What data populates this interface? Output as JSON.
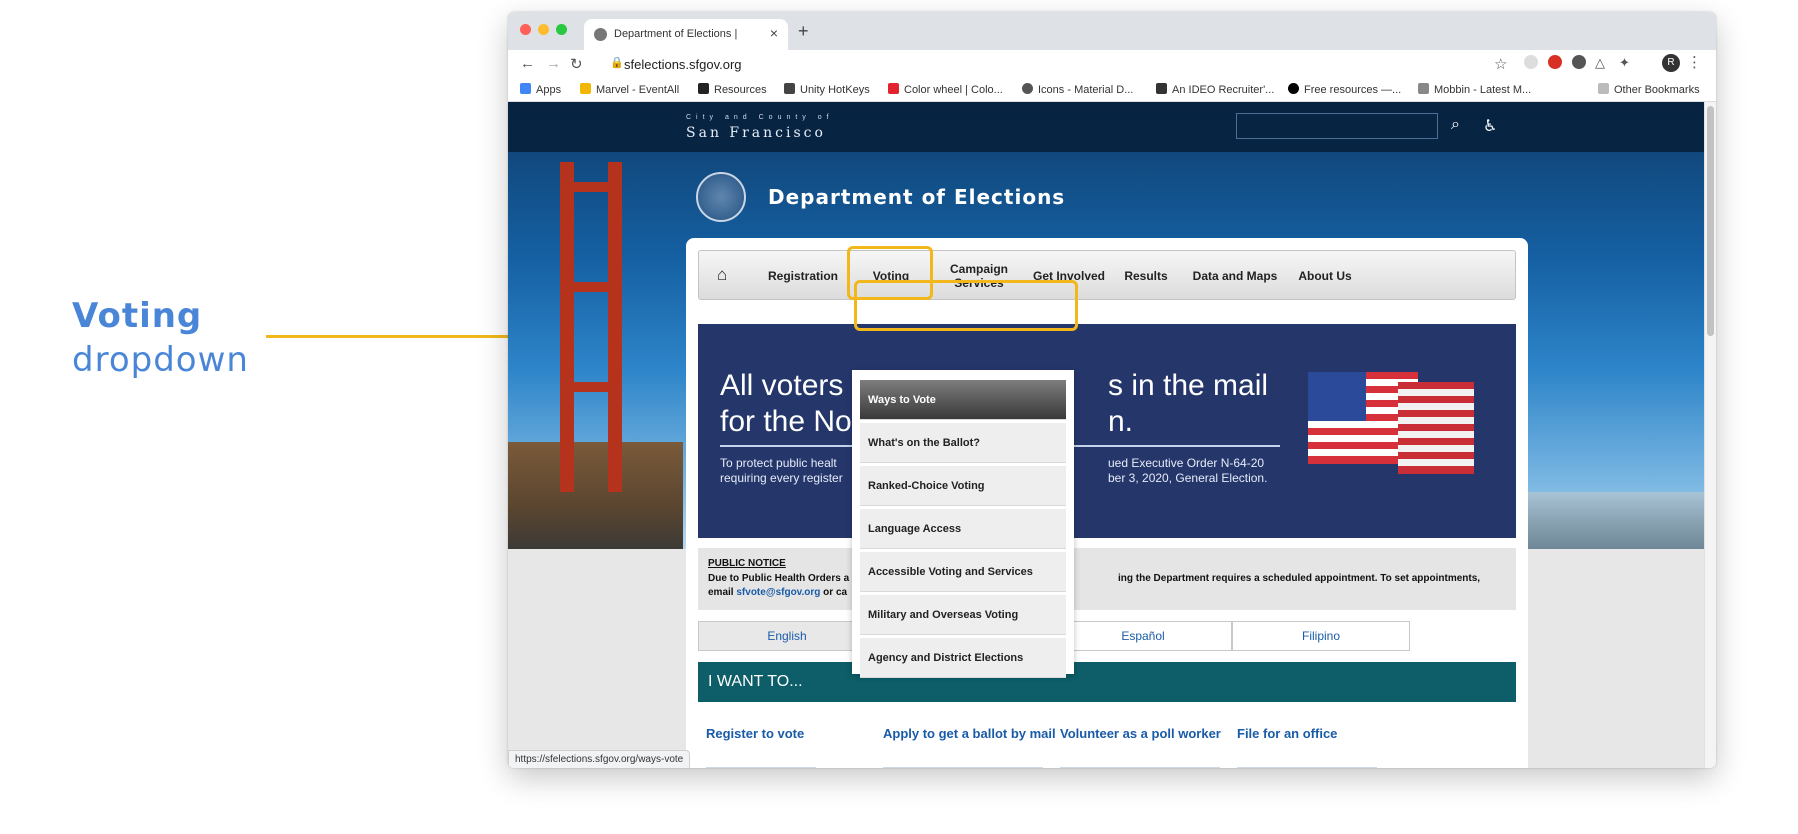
{
  "annotation": {
    "title": "Voting",
    "subtitle": "dropdown"
  },
  "browser": {
    "tab_title": "Department of Elections |",
    "url": "sfelections.sfgov.org",
    "avatar_letter": "R",
    "status_url": "https://sfelections.sfgov.org/ways-vote",
    "bookmarks": [
      "Apps",
      "Marvel - EventAll",
      "Resources",
      "Unity HotKeys",
      "Color wheel | Colo...",
      "Icons - Material D...",
      "An IDEO Recruiter'...",
      "Free resources —...",
      "Mobbin - Latest M...",
      "Other Bookmarks"
    ]
  },
  "site": {
    "city_small": "City and County of",
    "city_big": "San Francisco",
    "dept_title": "Department of Elections",
    "nav": [
      "Registration",
      "Voting",
      "Campaign Services",
      "Get Involved",
      "Results",
      "Data and Maps",
      "About Us"
    ],
    "banner_heading_line1": "All voters",
    "banner_heading_line1_right": "s in the mail",
    "banner_heading_line2": "for the No",
    "banner_heading_line2_right": "n.",
    "banner_text_left": "To protect public healt\nrequiring every register",
    "banner_text_right": "ued Executive Order N-64-20\nber 3, 2020, General Election.",
    "notice_title": "PUBLIC NOTICE",
    "notice_line1_left": "Due to Public Health Orders a",
    "notice_line1_right": "ing the Department requires a scheduled appointment. To set appointments,",
    "notice_line2_prefix": "email",
    "notice_email": "sfvote@sfgov.org",
    "notice_line2_suffix": "or ca",
    "languages": [
      "English",
      "Español",
      "Filipino"
    ],
    "iwant_title": "I WANT TO...",
    "iwant_links": [
      "Register to vote",
      "Apply to get a ballot by mail",
      "Volunteer as a poll worker",
      "File for an office"
    ]
  },
  "dropdown": {
    "items": [
      "Ways to Vote",
      "What's on the Ballot?",
      "Ranked-Choice Voting",
      "Language Access",
      "Accessible Voting and Services",
      "Military and Overseas Voting",
      "Agency and District Elections"
    ]
  },
  "colors": {
    "highlight": "#f2b71a",
    "annotation": "#4a86d8",
    "teal": "#0d5e68",
    "banner": "#25366b"
  }
}
